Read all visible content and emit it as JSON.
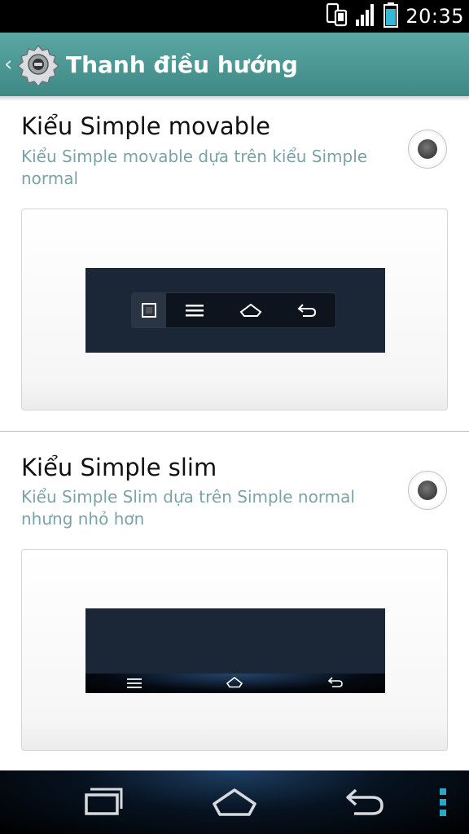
{
  "status_bar": {
    "time": "20:35",
    "icons": [
      "phone-sync-icon",
      "signal-icon",
      "battery-icon"
    ],
    "battery_color": "#35b8d8"
  },
  "action_bar": {
    "title": "Thanh điều hướng",
    "icon": "settings-gear-icon",
    "color": "#4b9794"
  },
  "options": [
    {
      "title": "Kiểu Simple movable",
      "summary": "Kiểu Simple movable dựa trên kiểu Simple normal",
      "selected": false,
      "preview_buttons": [
        "recent-square-icon",
        "menu-icon",
        "home-icon",
        "back-icon"
      ]
    },
    {
      "title": "Kiểu Simple slim",
      "summary": "Kiểu Simple Slim dựa trên Simple normal nhưng nhỏ hơn",
      "selected": false,
      "preview_buttons": [
        "menu-icon",
        "home-icon",
        "back-icon"
      ]
    }
  ],
  "nav_bar": {
    "buttons": [
      "recent-apps-icon",
      "home-icon",
      "back-icon",
      "overflow-menu-icon"
    ],
    "overflow_color": "#2aa9c7"
  }
}
